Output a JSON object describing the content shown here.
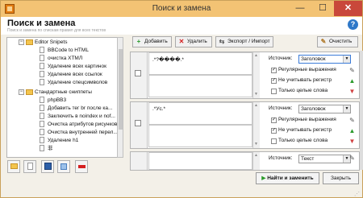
{
  "window": {
    "title": "Поиск и замена",
    "min": "—",
    "max": "☐",
    "close": "✕"
  },
  "header": {
    "title": "Поиск и замена",
    "subtitle": "Поиск и замена по спискам правил для всех текстов",
    "help": "?"
  },
  "tree": {
    "groups": [
      {
        "label": "Editor Snipets",
        "toggle": "−"
      },
      {
        "label": "Стандартные сниппеты",
        "toggle": "−"
      }
    ],
    "items_a": [
      "BBCode to HTML",
      "очистка XTMЛ",
      "Удаление всех картинок",
      "Удаление всех ссылок",
      "Удаление спецсимволов"
    ],
    "items_b": [
      "phpBB3",
      "Добавить тег br после ка...",
      "Заключить в noindex и nof...",
      "Очистка атрибутов рисунков",
      "Очистка внутренней перел...",
      "Удаление h1",
      "非"
    ]
  },
  "toolbar": {
    "add": "Добавить",
    "delete": "Удалить",
    "export": "Экспорт / Импорт",
    "clear": "Очистить"
  },
  "rules": [
    {
      "find": ".*?����.*",
      "source_label": "Источник:",
      "source": "Заголовок",
      "regex": "Регулярные выражения",
      "regex_checked": "✓",
      "ignore_case": "Не учитывать регистр",
      "ignore_checked": "✓",
      "whole": "Только целые слова",
      "whole_checked": ""
    },
    {
      "find": ".*Уc.*",
      "source_label": "Источник:",
      "source": "Заголовок",
      "regex": "Регулярные выражения",
      "regex_checked": "✓",
      "ignore_case": "Не учитывать регистр",
      "ignore_checked": "✓",
      "whole": "Только целые слова",
      "whole_checked": ""
    },
    {
      "find": "",
      "source_label": "Источник:",
      "source": "Текст"
    }
  ],
  "footer": {
    "find_replace": "Найти и заменить",
    "close": "Закрыть"
  },
  "colors": {
    "accent": "#3b7bd8",
    "titlebar": "#f3c374",
    "close": "#c9483a"
  }
}
